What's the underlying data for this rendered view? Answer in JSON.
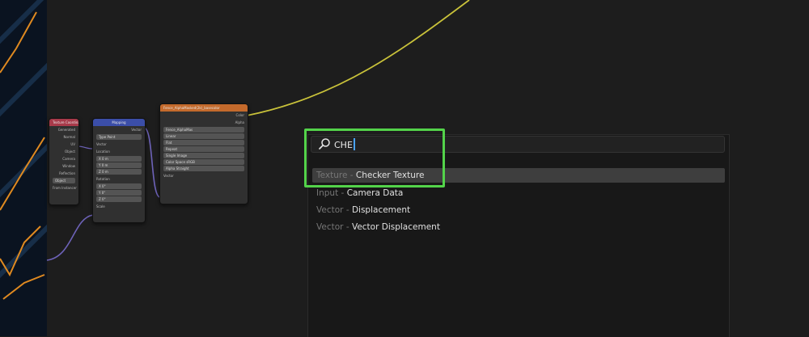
{
  "node_editor": {
    "nodes": {
      "texture_coordinate": {
        "title": "Texture Coordinate",
        "outputs": [
          "Generated",
          "Normal",
          "UV",
          "Object",
          "Camera",
          "Window",
          "Reflection"
        ],
        "object_label": "Object",
        "instancer_label": "From Instancer"
      },
      "mapping": {
        "title": "Mapping",
        "output": "Vector",
        "type_label": "Type",
        "type_value": "Point",
        "vector_label": "Vector",
        "location_label": "Location",
        "location": [
          "X",
          "Y",
          "Z"
        ],
        "location_values": [
          "0 m",
          "0 m",
          "0 m"
        ],
        "rotation_label": "Rotation",
        "rotation": [
          "X",
          "Y",
          "Z"
        ],
        "rotation_values": [
          "0°",
          "0°",
          "0°"
        ],
        "scale_label": "Scale"
      },
      "image_texture": {
        "title": "Fence_AlphaMasked(2k)_basecolor",
        "outputs": [
          "Color",
          "Alpha"
        ],
        "image_name": "Fence_AlphaMas",
        "interpolation": "Linear",
        "projection": "Flat",
        "extension": "Repeat",
        "source": "Single Image",
        "color_space_label": "Color Space",
        "color_space": "sRGB",
        "alpha_label": "Alpha",
        "alpha": "Straight",
        "input": "Vector"
      }
    }
  },
  "search": {
    "query": "CHE",
    "icon": "search-icon",
    "results": [
      {
        "category": "Texture",
        "name": "Checker Texture",
        "selected": true
      },
      {
        "category": "Input",
        "name": "Camera Data",
        "selected": false
      },
      {
        "category": "Vector",
        "name": "Displacement",
        "selected": false
      },
      {
        "category": "Vector",
        "name": "Vector Displacement",
        "selected": false
      }
    ],
    "separator": "-"
  },
  "colors": {
    "highlight": "#53d34a",
    "wire_yellow": "#c9c23a",
    "wire_purple": "#6d62b8",
    "texture_header": "#c46a2c",
    "vector_header": "#3b4ea8",
    "input_header": "#a83a4a"
  }
}
